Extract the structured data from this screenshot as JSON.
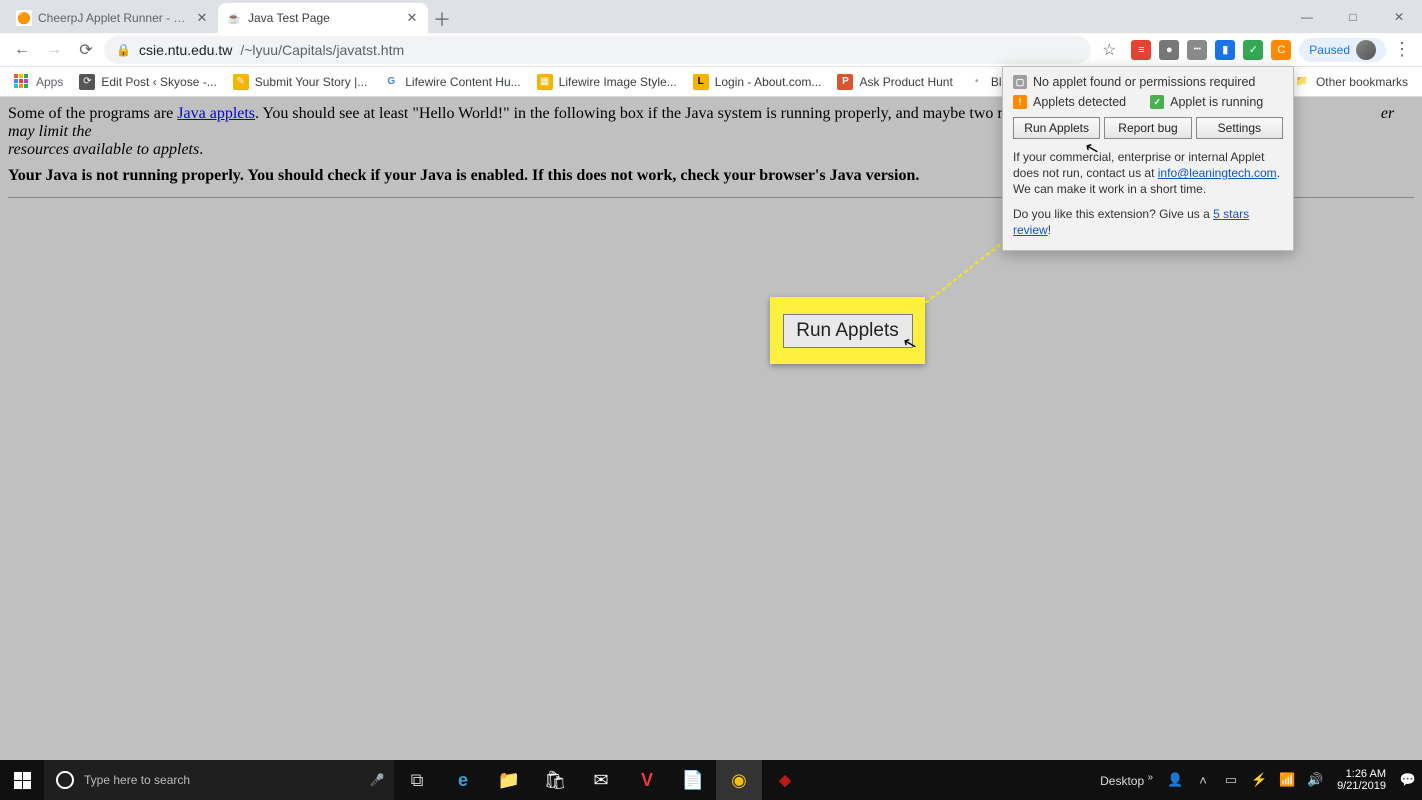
{
  "window": {
    "minimize": "—",
    "maximize": "□",
    "close": "✕"
  },
  "tabs": [
    {
      "title": "CheerpJ Applet Runner - Chrome",
      "favicon": "🟠"
    },
    {
      "title": "Java Test Page",
      "favicon": "☕"
    }
  ],
  "newtab": "＋",
  "nav": {
    "back": "←",
    "forward": "→",
    "reload": "⟳"
  },
  "omnibox": {
    "lock": "🔒",
    "host": "csie.ntu.edu.tw",
    "path": "/~lyuu/Capitals/javatst.htm"
  },
  "addr_icons": {
    "star": "☆"
  },
  "profile": {
    "label": "Paused"
  },
  "extensions": [
    {
      "name": "todoist",
      "bg": "#e44332",
      "glyph": "≡"
    },
    {
      "name": "grey-ext",
      "bg": "#777",
      "glyph": "●"
    },
    {
      "name": "pass-ext",
      "bg": "#2a6fdb",
      "glyph": "•••"
    },
    {
      "name": "blue-ext",
      "bg": "#1a73e8",
      "glyph": "▮"
    },
    {
      "name": "green-ext",
      "bg": "#34a853",
      "glyph": "✓"
    },
    {
      "name": "cheerpj",
      "bg": "#ff8a00",
      "glyph": "C"
    }
  ],
  "bookmarks": [
    {
      "label": "Apps",
      "fav": "grid"
    },
    {
      "label": "Edit Post ‹ Skyose -...",
      "favbg": "#555",
      "glyph": "⟳"
    },
    {
      "label": "Submit Your Story |...",
      "favbg": "#f5b400",
      "glyph": "✎"
    },
    {
      "label": "Lifewire Content Hu...",
      "favbg": "#fff",
      "glyph": "G",
      "gc": "#4285f4"
    },
    {
      "label": "Lifewire Image Style...",
      "favbg": "#f4b400",
      "glyph": "▦"
    },
    {
      "label": "Login - About.com...",
      "favbg": "#f5b400",
      "glyph": "L"
    },
    {
      "label": "Ask Product Hunt",
      "favbg": "#da552f",
      "glyph": "P"
    },
    {
      "label": "Blockchain Be...",
      "favbg": "#9e9e9e",
      "glyph": "•"
    }
  ],
  "other_bookmarks": {
    "label": "Other bookmarks",
    "glyph": "📁"
  },
  "page": {
    "p1a": "Some of the programs are ",
    "p1link": "Java applets",
    "p1b": ". You should see at least \"Hello World!\" in the following box if the Java system is running properly, and maybe two more lines i",
    "p1c": "er may limit the ",
    "p1d": "resources available to applets",
    "p1e": ".",
    "p2": "Your Java is not running properly. You should check if your Java is enabled. If this does not work, check your browser's Java version."
  },
  "callout": {
    "label": "Run Applets"
  },
  "popup": {
    "s1": "No applet found or permissions required",
    "s2": "Applets detected",
    "s3": "Applet is running",
    "btn1": "Run Applets",
    "btn2": "Report bug",
    "btn3": "Settings",
    "note_a": "If your commercial, enterprise or internal Applet does not run, contact us at ",
    "note_link": "info@leaningtech.com",
    "note_b": ". We can make it work in a short time.",
    "review_a": "Do you like this extension? Give us a ",
    "review_link": "5 stars review",
    "review_b": "!"
  },
  "taskbar": {
    "search_placeholder": "Type here to search",
    "pinned": [
      {
        "name": "task-view",
        "glyph": "⧉",
        "color": "#ccc"
      },
      {
        "name": "edge",
        "glyph": "e",
        "color": "#3aa0da"
      },
      {
        "name": "explorer",
        "glyph": "📁",
        "color": "#f8d26a"
      },
      {
        "name": "store",
        "glyph": "🛍",
        "color": "#ccc"
      },
      {
        "name": "mail",
        "glyph": "✉",
        "color": "#ccc"
      },
      {
        "name": "vivaldi",
        "glyph": "V",
        "color": "#ef3939"
      },
      {
        "name": "notepad",
        "glyph": "📄",
        "color": "#8ac5e6"
      },
      {
        "name": "chrome",
        "glyph": "◉",
        "color": "#f4c20d"
      },
      {
        "name": "mcafee",
        "glyph": "⬥",
        "color": "#c01818"
      }
    ],
    "desktop": "Desktop",
    "chev": "»",
    "tray": [
      "👤",
      "˄",
      "▭",
      "⚡",
      "📶",
      "🔊"
    ],
    "time": "1:26 AM",
    "date": "9/21/2019",
    "action": "💬"
  }
}
